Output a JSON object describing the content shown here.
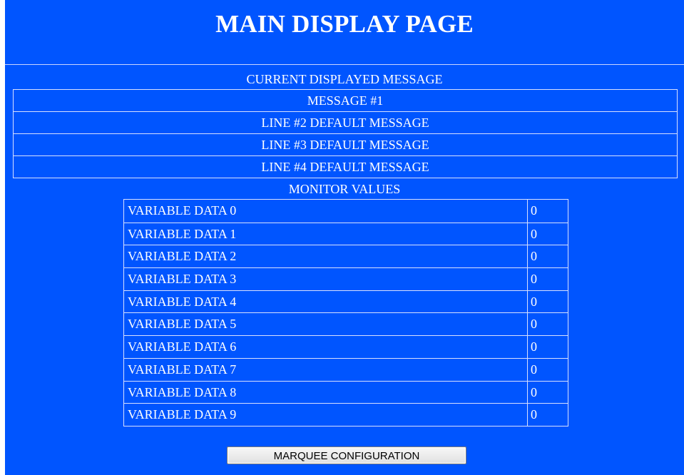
{
  "page": {
    "title": "MAIN DISPLAY PAGE"
  },
  "message_section": {
    "heading": "CURRENT DISPLAYED MESSAGE",
    "lines": [
      "MESSAGE #1",
      "LINE #2 DEFAULT MESSAGE",
      "LINE #3 DEFAULT MESSAGE",
      "LINE #4 DEFAULT MESSAGE"
    ]
  },
  "monitor_section": {
    "heading": "MONITOR VALUES",
    "rows": [
      {
        "label": "VARIABLE DATA 0",
        "value": "0"
      },
      {
        "label": "VARIABLE DATA 1",
        "value": "0"
      },
      {
        "label": "VARIABLE DATA 2",
        "value": "0"
      },
      {
        "label": "VARIABLE DATA 3",
        "value": "0"
      },
      {
        "label": "VARIABLE DATA 4",
        "value": "0"
      },
      {
        "label": "VARIABLE DATA 5",
        "value": "0"
      },
      {
        "label": "VARIABLE DATA 6",
        "value": "0"
      },
      {
        "label": "VARIABLE DATA 7",
        "value": "0"
      },
      {
        "label": "VARIABLE DATA 8",
        "value": "0"
      },
      {
        "label": "VARIABLE DATA 9",
        "value": "0"
      }
    ]
  },
  "actions": {
    "marquee_config_label": "MARQUEE CONFIGURATION"
  },
  "colors": {
    "page_background": "#0055ff",
    "text": "#ffffff",
    "border": "#d8e0ff"
  }
}
